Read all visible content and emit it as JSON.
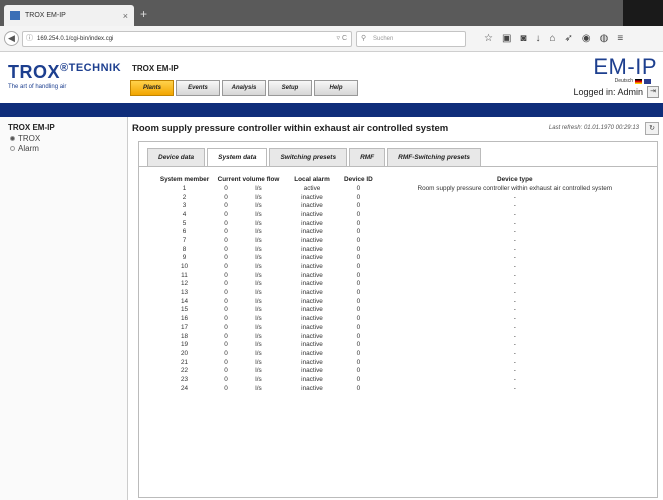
{
  "browser": {
    "tab_title": "TROX EM-IP",
    "tab_close": "×",
    "new_tab": "+",
    "url": "169.254.0.1/cgi-bin/index.cgi",
    "url_info_icon": "ⓘ",
    "url_right": "▿ C",
    "search_placeholder": "Suchen",
    "toolbar_icons": [
      "☆",
      "▣",
      "◙",
      "↓",
      "⌂",
      "➶",
      "◉",
      "◍",
      "≡"
    ]
  },
  "header": {
    "logo_word": "TROX",
    "logo_suffix": "TECHNIK",
    "logo_mark": "®",
    "logo_tagline": "The art of handling air",
    "app_title": "TROX EM-IP",
    "brand": "EM-IP",
    "language": "Deutsch",
    "login_text": "Logged in: Admin",
    "menus": [
      {
        "label": "Plants",
        "active": true
      },
      {
        "label": "Events",
        "active": false
      },
      {
        "label": "Analysis",
        "active": false
      },
      {
        "label": "Setup",
        "active": false
      },
      {
        "label": "Help",
        "active": false
      }
    ]
  },
  "colors": {
    "accent": "#f2a500",
    "navy": "#0f2d7a",
    "brand_blue": "#1d3f8f"
  },
  "sidebar": {
    "heading": "TROX EM-IP",
    "items": [
      {
        "label": "TROX",
        "selected": true
      },
      {
        "label": "Alarm",
        "selected": false
      }
    ]
  },
  "main": {
    "title": "Room supply pressure controller within exhaust air controlled system",
    "last_refresh": "Last refresh: 01.01.1970 00:29:13",
    "refresh_icon": "↻",
    "tabs": [
      {
        "label": "Device data",
        "active": false
      },
      {
        "label": "System data",
        "active": true
      },
      {
        "label": "Switching presets",
        "active": false
      },
      {
        "label": "RMF",
        "active": false
      },
      {
        "label": "RMF-Switching presets",
        "active": false
      }
    ],
    "table": {
      "headers": [
        "System member",
        "Current volume flow",
        "",
        "Local alarm",
        "Device ID",
        "Device type"
      ],
      "rows": [
        [
          "1",
          "0",
          "l/s",
          "active",
          "0",
          "Room supply pressure controller within exhaust air controlled system"
        ],
        [
          "2",
          "0",
          "l/s",
          "inactive",
          "0",
          "-"
        ],
        [
          "3",
          "0",
          "l/s",
          "inactive",
          "0",
          "-"
        ],
        [
          "4",
          "0",
          "l/s",
          "inactive",
          "0",
          "-"
        ],
        [
          "5",
          "0",
          "l/s",
          "inactive",
          "0",
          "-"
        ],
        [
          "6",
          "0",
          "l/s",
          "inactive",
          "0",
          "-"
        ],
        [
          "7",
          "0",
          "l/s",
          "inactive",
          "0",
          "-"
        ],
        [
          "8",
          "0",
          "l/s",
          "inactive",
          "0",
          "-"
        ],
        [
          "9",
          "0",
          "l/s",
          "inactive",
          "0",
          "-"
        ],
        [
          "10",
          "0",
          "l/s",
          "inactive",
          "0",
          "-"
        ],
        [
          "11",
          "0",
          "l/s",
          "inactive",
          "0",
          "-"
        ],
        [
          "12",
          "0",
          "l/s",
          "inactive",
          "0",
          "-"
        ],
        [
          "13",
          "0",
          "l/s",
          "inactive",
          "0",
          "-"
        ],
        [
          "14",
          "0",
          "l/s",
          "inactive",
          "0",
          "-"
        ],
        [
          "15",
          "0",
          "l/s",
          "inactive",
          "0",
          "-"
        ],
        [
          "16",
          "0",
          "l/s",
          "inactive",
          "0",
          "-"
        ],
        [
          "17",
          "0",
          "l/s",
          "inactive",
          "0",
          "-"
        ],
        [
          "18",
          "0",
          "l/s",
          "inactive",
          "0",
          "-"
        ],
        [
          "19",
          "0",
          "l/s",
          "inactive",
          "0",
          "-"
        ],
        [
          "20",
          "0",
          "l/s",
          "inactive",
          "0",
          "-"
        ],
        [
          "21",
          "0",
          "l/s",
          "inactive",
          "0",
          "-"
        ],
        [
          "22",
          "0",
          "l/s",
          "inactive",
          "0",
          "-"
        ],
        [
          "23",
          "0",
          "l/s",
          "inactive",
          "0",
          "-"
        ],
        [
          "24",
          "0",
          "l/s",
          "inactive",
          "0",
          "-"
        ]
      ]
    }
  }
}
